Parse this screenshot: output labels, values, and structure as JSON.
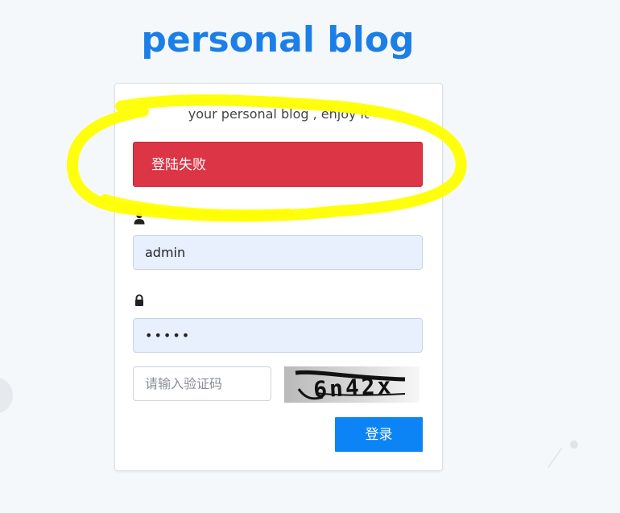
{
  "site": {
    "title": "personal blog"
  },
  "login": {
    "subtitle": "your personal blog , enjoy it",
    "error_message": "登陆失败",
    "username_value": "admin",
    "password_value": "•••••",
    "captcha_placeholder": "请输入验证码",
    "captcha_code": "6n42x",
    "submit_label": "登录"
  },
  "icons": {
    "username": "user-icon",
    "password": "lock-icon"
  },
  "colors": {
    "title": "#1c7fe8",
    "error": "#dc3545",
    "button": "#0d84f5",
    "input_fill": "#e8f0fe",
    "highlight": "#ffff00"
  }
}
